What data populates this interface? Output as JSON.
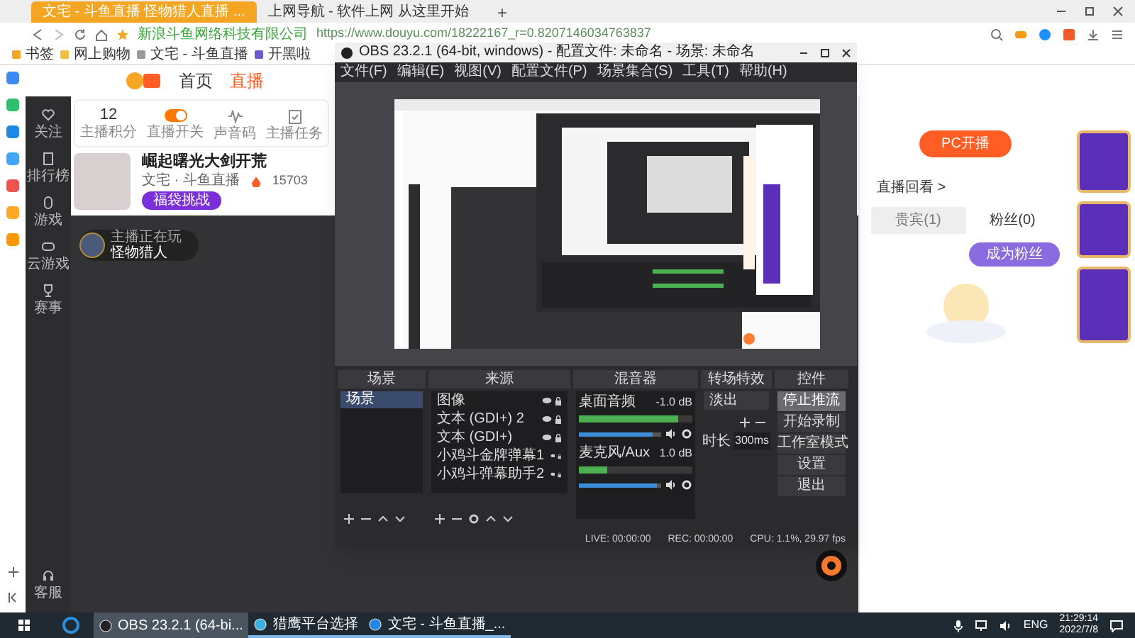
{
  "browser": {
    "tabs": [
      {
        "label": "文宅 - 斗鱼直播 怪物猎人直播 ...",
        "selected": true
      },
      {
        "label": "上网导航 - 软件上网 从这里开始",
        "selected": false
      }
    ],
    "new_tab": "+",
    "address": {
      "site": "新浪斗鱼网络科技有限公司",
      "url": "https://www.douyu.com/18222167_r=0.8207146034763837"
    },
    "bookmarks": [
      "书签",
      "网上购物",
      "文宅 - 斗鱼直播",
      "开黑啦"
    ]
  },
  "site_nav": [
    {
      "label": "首页",
      "selected": false
    },
    {
      "label": "直播",
      "selected": true
    }
  ],
  "sidebar": {
    "items": [
      "关注",
      "排行榜",
      "游戏",
      "云游戏",
      "赛事"
    ],
    "footer": "客服"
  },
  "stats": [
    {
      "kind": "count",
      "value": "12",
      "label": "主播积分"
    },
    {
      "kind": "toggle",
      "on": true,
      "label": "直播开关"
    },
    {
      "kind": "wave",
      "label": "声音码"
    },
    {
      "kind": "task",
      "label": "主播任务"
    }
  ],
  "streamer": {
    "title": "崛起曙光大剑开荒",
    "category": "文宅 · 斗鱼直播",
    "heat": "15703",
    "button": "福袋挑战"
  },
  "now_playing": {
    "label": "主播正在玩",
    "game": "怪物猎人"
  },
  "obs": {
    "title": "OBS 23.2.1 (64-bit, windows) - 配置文件: 未命名 - 场景: 未命名",
    "menu": [
      "文件(F)",
      "编辑(E)",
      "视图(V)",
      "配置文件(P)",
      "场景集合(S)",
      "工具(T)",
      "帮助(H)"
    ],
    "scenes": {
      "title": "场景",
      "items": [
        {
          "label": "场景",
          "selected": true
        }
      ]
    },
    "sources": {
      "title": "来源",
      "items": [
        "图像",
        "文本 (GDI+) 2",
        "文本 (GDI+)",
        "小鸡斗金牌弹幕1",
        "小鸡斗弹幕助手2"
      ]
    },
    "mixer": {
      "title": "混音器",
      "channels": [
        {
          "name": "桌面音频",
          "reading": "-1.0 dB",
          "meter": {
            "level": 0.88
          },
          "volume": {
            "level": 0.9
          }
        },
        {
          "name": "麦克风/Aux",
          "reading": "1.0 dB",
          "meter": {
            "level": 0.25
          },
          "volume": {
            "level": 0.95
          }
        }
      ]
    },
    "transitions": {
      "title": "转场特效",
      "transition": "淡出",
      "duration_label": "时长",
      "duration": "300ms"
    },
    "controls": {
      "title": "控件",
      "buttons": [
        {
          "label": "停止推流",
          "active": true
        },
        {
          "label": "开始录制",
          "active": false
        },
        {
          "label": "工作室模式",
          "active": false
        },
        {
          "label": "设置",
          "active": false
        },
        {
          "label": "退出",
          "active": false
        }
      ]
    },
    "status": [
      "LIVE: 00:00:00",
      "REC: 00:00:00",
      "CPU: 1.1%, 29.97 fps"
    ]
  },
  "right_panel": {
    "pc_button": "PC开播",
    "replay": "直播回看 >",
    "tabs": [
      {
        "label": "贵宾(1)",
        "selected": false
      },
      {
        "label": "粉丝(0)",
        "selected": true
      }
    ],
    "fan_button": "成为粉丝"
  },
  "taskbar": {
    "items": [
      {
        "label": "OBS 23.2.1 (64-bi...",
        "selected": true
      },
      {
        "label": "猎鹰平台选择",
        "selected": false
      },
      {
        "label": "文宅 - 斗鱼直播_...",
        "selected": false
      }
    ],
    "lang": "ENG",
    "time": "21:29:14",
    "date": "2022/7/8"
  }
}
